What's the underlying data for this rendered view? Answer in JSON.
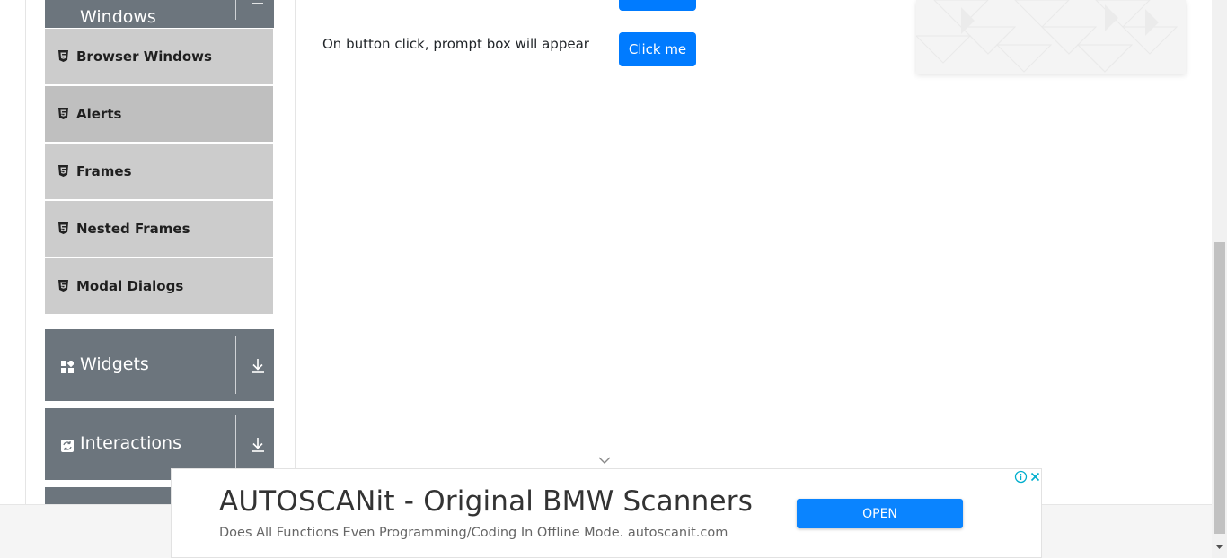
{
  "sidebar": {
    "top_group": {
      "title": "Windows",
      "icon": "windows-icon"
    },
    "items": [
      {
        "label": "Browser Windows",
        "icon": "html5-icon"
      },
      {
        "label": "Alerts",
        "icon": "html5-icon",
        "active": true
      },
      {
        "label": "Frames",
        "icon": "html5-icon"
      },
      {
        "label": "Nested Frames",
        "icon": "html5-icon"
      },
      {
        "label": "Modal Dialogs",
        "icon": "html5-icon"
      }
    ],
    "groups": [
      {
        "title": "Widgets",
        "icon": "widgets-grid-icon",
        "toggle_icon": "download-arrow-icon"
      },
      {
        "title": "Interactions",
        "icon": "interactions-icon",
        "toggle_icon": "download-arrow-icon"
      }
    ]
  },
  "main": {
    "prompt_text": "On button click, prompt box will appear",
    "prompt_button_label": "Click me"
  },
  "ad": {
    "title": "AUTOSCANit - Original BMW Scanners",
    "description": "Does All Functions Even Programming/Coding In Offline Mode. autoscanit.com",
    "open_label": "OPEN"
  },
  "colors": {
    "group_header": "#6c757d",
    "menu_item": "#cccccc",
    "menu_item_active": "#bfbfbf",
    "primary": "#007bff",
    "ad_button": "#0a84ff"
  }
}
